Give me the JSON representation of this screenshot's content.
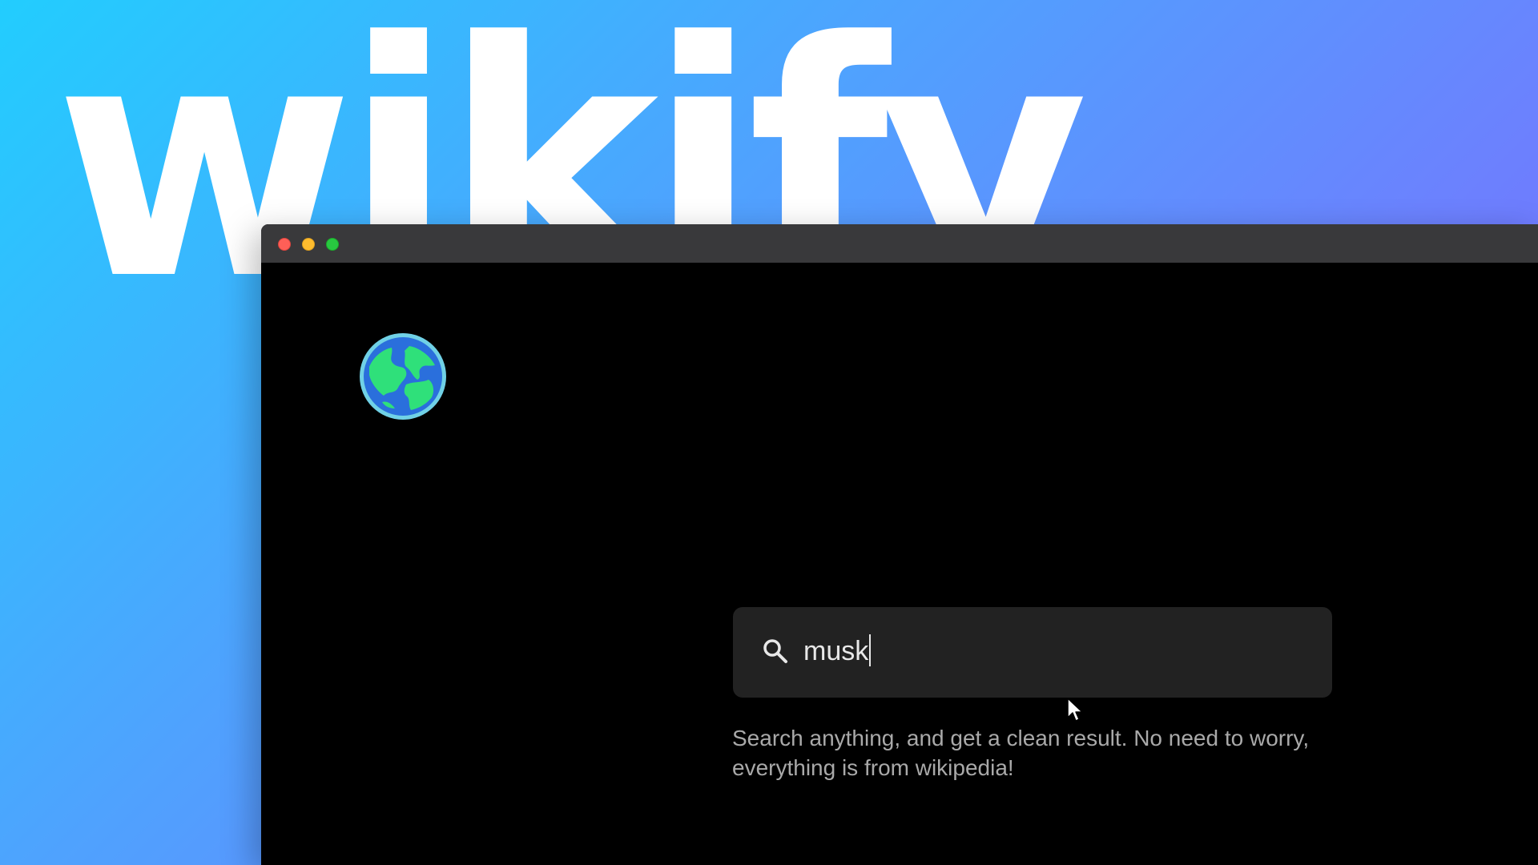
{
  "hero": {
    "title": "wikify",
    "colors": {
      "gradient_start": "#22cdfe",
      "gradient_mid": "#4fa2fe",
      "gradient_end": "#7e5cfe",
      "title_text": "#ffffff"
    }
  },
  "window": {
    "controls": [
      {
        "name": "close",
        "color": "#fe5f57"
      },
      {
        "name": "minimize",
        "color": "#febc2e"
      },
      {
        "name": "zoom",
        "color": "#28c840"
      }
    ],
    "background": "#000000",
    "titlebar_color": "#39393b"
  },
  "app": {
    "logo_icon": "globe-icon",
    "search": {
      "icon": "search-icon",
      "value": "musk",
      "background": "#222222",
      "text_color": "#e8e8e8"
    },
    "hint": "Search anything, and get a clean result. No need to worry, everything is from wikipedia!"
  },
  "cursor": {
    "icon": "mouse-pointer-icon"
  }
}
